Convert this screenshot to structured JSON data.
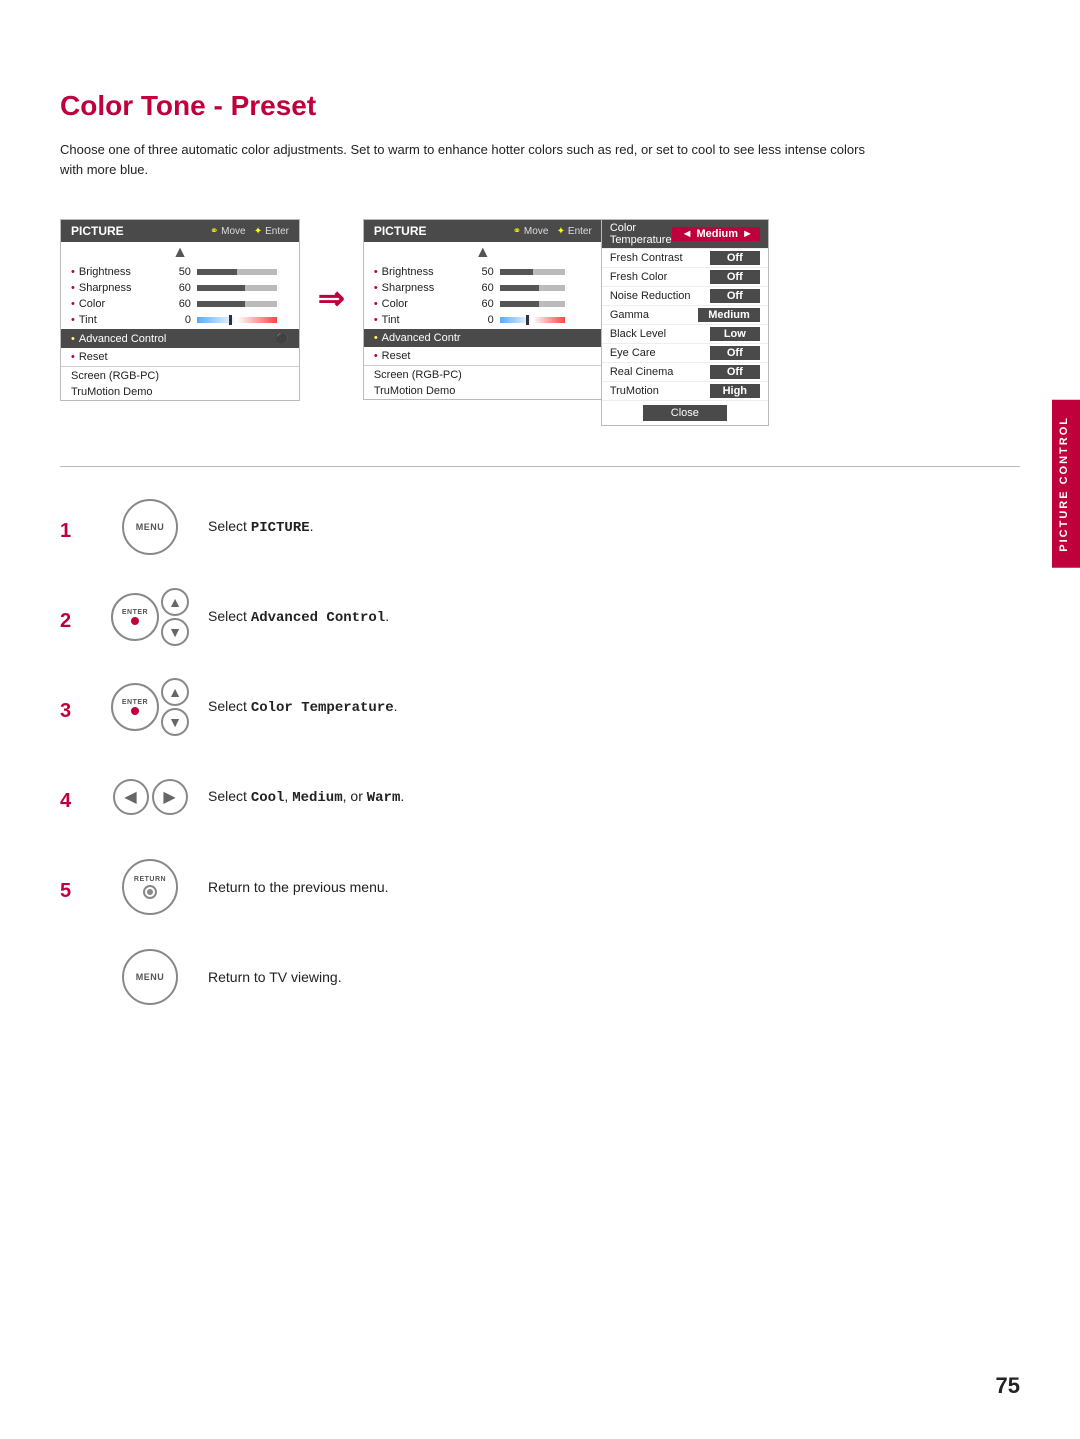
{
  "page": {
    "title": "Color Tone - Preset",
    "description": "Choose one of three automatic color adjustments. Set to warm to enhance hotter colors such as red, or set to cool to see less intense colors with more blue.",
    "sidebar_label": "PICTURE CONTROL",
    "page_number": "75"
  },
  "left_menu": {
    "header": "PICTURE",
    "nav_hint": "Move",
    "enter_hint": "Enter",
    "items": [
      {
        "label": "Brightness",
        "value": "50",
        "bar_pct": 50
      },
      {
        "label": "Sharpness",
        "value": "60",
        "bar_pct": 60
      },
      {
        "label": "Color",
        "value": "60",
        "bar_pct": 60
      },
      {
        "label": "Tint",
        "value": "0",
        "is_tint": true
      },
      {
        "label": "Advanced Control",
        "highlight": true
      },
      {
        "label": "Reset"
      }
    ],
    "bottom": [
      "Screen (RGB-PC)",
      "TruMotion Demo"
    ]
  },
  "right_menu": {
    "header": "PICTURE",
    "nav_hint": "Move",
    "enter_hint": "Enter",
    "items": [
      {
        "label": "Brightness",
        "value": "50",
        "bar_pct": 50
      },
      {
        "label": "Sharpness",
        "value": "60",
        "bar_pct": 60
      },
      {
        "label": "Color",
        "value": "60",
        "bar_pct": 60
      },
      {
        "label": "Tint",
        "value": "0",
        "is_tint": true
      },
      {
        "label": "Advanced Control",
        "highlight": true
      },
      {
        "label": "Reset"
      }
    ],
    "bottom": [
      "Screen (RGB-PC)",
      "TruMotion Demo"
    ]
  },
  "popup_menu": {
    "title": "Color Temperature",
    "title_left": "◄",
    "title_val": "Medium",
    "title_right": "►",
    "items": [
      {
        "label": "Fresh Contrast",
        "value": "Off"
      },
      {
        "label": "Fresh Color",
        "value": "Off"
      },
      {
        "label": "Noise Reduction",
        "value": "Off"
      },
      {
        "label": "Gamma",
        "value": "Medium"
      },
      {
        "label": "Black Level",
        "value": "Low"
      },
      {
        "label": "Eye Care",
        "value": "Off"
      },
      {
        "label": "Real Cinema",
        "value": "Off"
      },
      {
        "label": "TruMotion",
        "value": "High"
      }
    ],
    "close_label": "Close"
  },
  "steps": [
    {
      "number": "1",
      "icon": "menu-button",
      "has_arrows": false,
      "text": "Select ",
      "bold": "PICTURE",
      "text_after": "."
    },
    {
      "number": "2",
      "icon": "enter-arrows",
      "has_arrows": true,
      "text": "Select ",
      "bold": "Advanced Control",
      "text_after": "."
    },
    {
      "number": "3",
      "icon": "enter-arrows",
      "has_arrows": true,
      "text": "Select ",
      "bold": "Color Temperature",
      "text_after": "."
    },
    {
      "number": "4",
      "icon": "lr-arrows",
      "has_arrows": false,
      "text": "Select ",
      "bold": "Cool",
      "text_mid1": ", ",
      "bold2": "Medium",
      "text_mid2": ", or ",
      "bold3": "Warm",
      "text_after": "."
    },
    {
      "number": "5",
      "icon": "return-button",
      "has_arrows": false,
      "text": "Return to the previous menu.",
      "bold": ""
    },
    {
      "number": "",
      "icon": "menu-button2",
      "has_arrows": false,
      "text": "Return to TV viewing.",
      "bold": ""
    }
  ]
}
